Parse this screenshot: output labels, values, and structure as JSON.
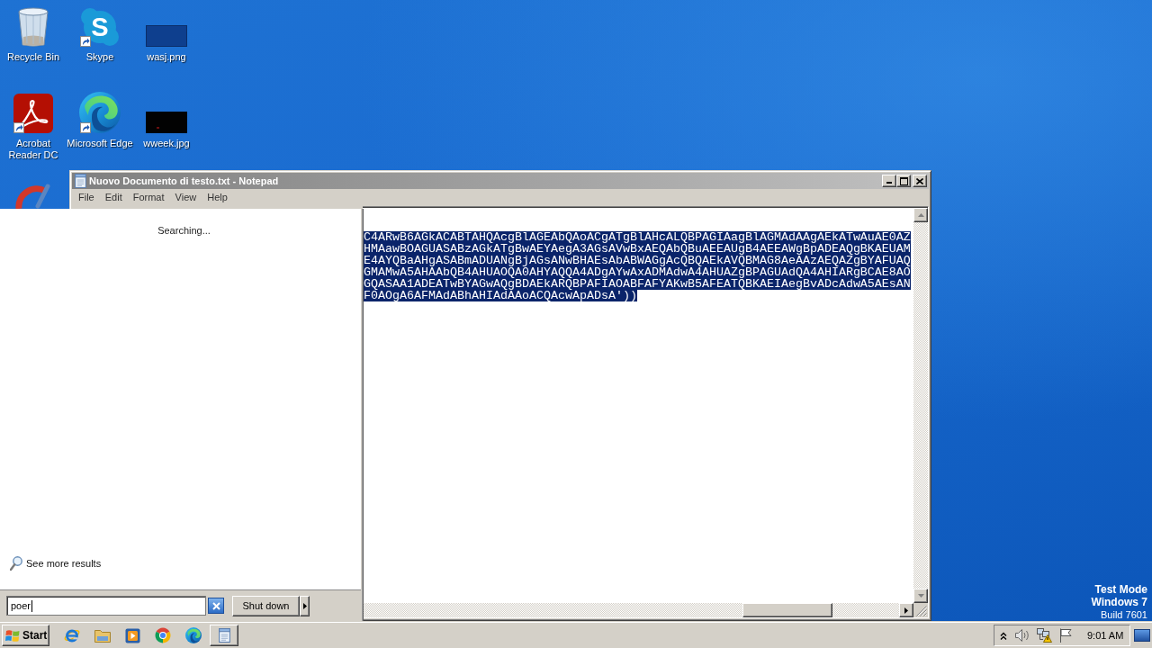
{
  "desktop": {
    "icons": [
      {
        "kind": "recycle-bin",
        "label": "Recycle Bin",
        "shortcut": false
      },
      {
        "kind": "skype",
        "label": "Skype",
        "logo_letter": "S",
        "shortcut": true
      },
      {
        "kind": "png-image",
        "label": "wasj.png",
        "shortcut": false
      },
      {
        "kind": "acrobat",
        "label": "Acrobat Reader DC",
        "shortcut": true
      },
      {
        "kind": "edge",
        "label": "Microsoft Edge",
        "shortcut": true
      },
      {
        "kind": "jpg-image",
        "label": "wweek.jpg",
        "shortcut": false
      },
      {
        "kind": "cleaner"
      }
    ]
  },
  "notepad": {
    "title": "Nuovo Documento di testo.txt - Notepad",
    "active": false,
    "menu": [
      "File",
      "Edit",
      "Format",
      "View",
      "Help"
    ],
    "lines": [
      {
        "text": "C4ARwB6AGkACABTAHQAcgBlAGEAbQAoACgATgBlAHcALQBPAGIAagBlAGMAdAAgAEkATwAuAE0AZ",
        "selected": true
      },
      {
        "text": "HMAawBOAGUASABzAGkATgBwAEYAegA3AGsAVwBxAEQAbQBuAEEAUgB4AEEAWgBpADEAQgBKAEUAM",
        "selected": true
      },
      {
        "text": "E4AYQBaAHgASABmADUANgBjAGsANwBHAEsAbABWAGgAcQBQAEkAVQBMAG8AeAAzAEQAZgBYAFUAQ",
        "selected": true
      },
      {
        "text": "GMAMwA5AHAAbQB4AHUAOQA0AHYAQQA4ADgAYwAxADMAdwA4AHUAZgBPAGUAdQA4AHIARgBCAE8AO",
        "selected": true
      },
      {
        "text": "GQASAA1ADEATwBYAGwAQgBDAEkARQBPAFIAOABFAFYAKwB5AFEATQBKAEIAegBvADcAdwA5AEsAN",
        "selected": true
      },
      {
        "text": "F0AOgA6AFMAdABhAHIAdAAoACQAcwApADsA'))",
        "selected": true
      }
    ]
  },
  "start_menu": {
    "status": "Searching...",
    "see_more": "See more results",
    "search": {
      "value": "poer",
      "focused": true
    },
    "shutdown": "Shut down"
  },
  "taskbar": {
    "start": "Start",
    "tasks": [
      {
        "kind": "notepad",
        "selected": false
      }
    ],
    "clock": "9:01 AM"
  },
  "os_watermark": [
    {
      "text": "Test Mode",
      "bold": true
    },
    {
      "text": "Windows 7",
      "bold": true
    },
    {
      "text": "Build 7601",
      "bold": false
    }
  ]
}
